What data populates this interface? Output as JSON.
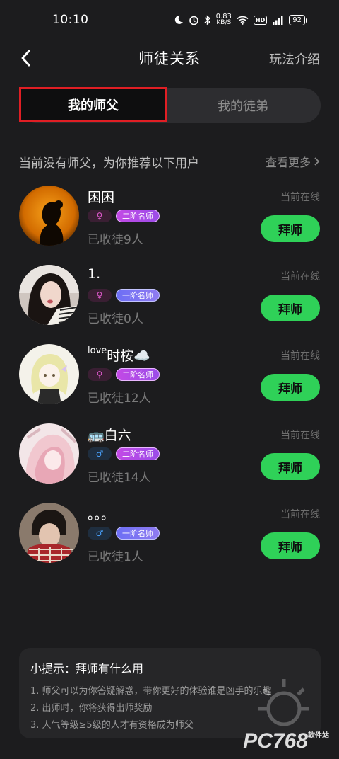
{
  "status_bar": {
    "time": "10:10",
    "net_speed_value": "0.83",
    "net_speed_unit": "KB/S",
    "hd_label": "HD",
    "battery": "92"
  },
  "nav": {
    "title": "师徒关系",
    "right_link": "玩法介绍",
    "back_icon": "chevron-left-icon"
  },
  "tabs": [
    {
      "label": "我的师父",
      "active": true
    },
    {
      "label": "我的徒弟",
      "active": false
    }
  ],
  "recommend": {
    "title": "当前没有师父，为你推荐以下用户",
    "more_label": "查看更多"
  },
  "users": [
    {
      "name": "困困",
      "gender": "female",
      "gender_symbol": "♀",
      "level": "二阶名师",
      "stat": "已收徒9人",
      "online": "当前在线",
      "action": "拜师"
    },
    {
      "name": "1.",
      "gender": "female",
      "gender_symbol": "♀",
      "level": "一阶名师",
      "stat": "已收徒0人",
      "online": "当前在线",
      "action": "拜师"
    },
    {
      "name_prefix": "love",
      "name": "时桉☁️",
      "gender": "female",
      "gender_symbol": "♀",
      "level": "二阶名师",
      "stat": "已收徒12人",
      "online": "当前在线",
      "action": "拜师"
    },
    {
      "name": "🚌白六",
      "gender": "male",
      "gender_symbol": "♂",
      "level": "二阶名师",
      "stat": "已收徒14人",
      "online": "当前在线",
      "action": "拜师"
    },
    {
      "name": "。。。",
      "gender": "male",
      "gender_symbol": "♂",
      "level": "一阶名师",
      "stat": "已收徒1人",
      "online": "当前在线",
      "action": "拜师"
    }
  ],
  "tips": {
    "title": "小提示：拜师有什么用",
    "lines": [
      "1. 师父可以为你答疑解惑，带你更好的体验谁是凶手的乐趣",
      "2. 出师时，你将获得出师奖励",
      "3. 人气等级≥5级的人才有资格成为师父"
    ]
  },
  "watermark": {
    "text": "PC768",
    "sub": "软件站"
  },
  "colors": {
    "background": "#1c1c1e",
    "accent_green": "#2fd158",
    "tab_highlight": "#e01e24",
    "female": "#e35bd0",
    "male": "#4aa3ff"
  }
}
